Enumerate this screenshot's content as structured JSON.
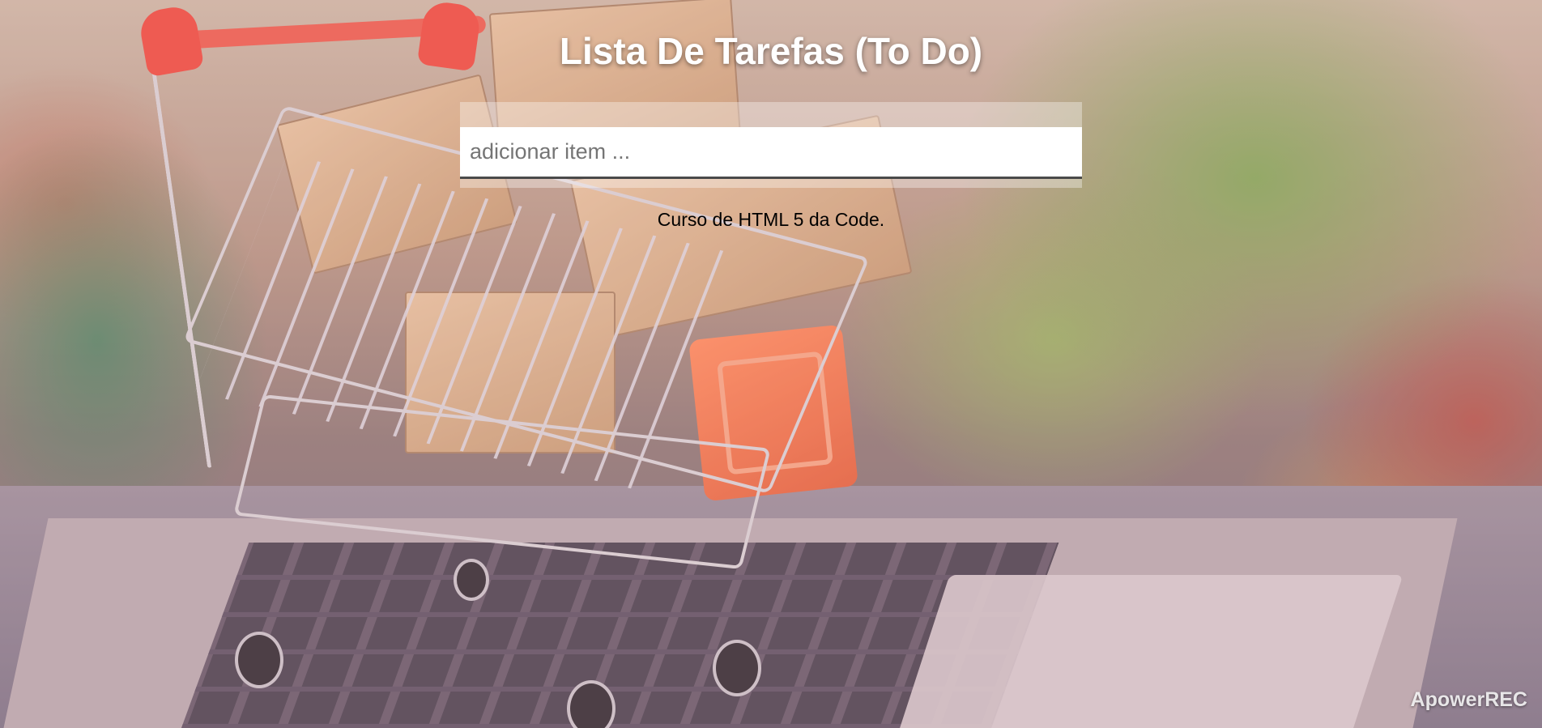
{
  "header": {
    "title": "Lista De Tarefas (To Do)"
  },
  "form": {
    "input_placeholder": "adicionar item ...",
    "input_value": ""
  },
  "credit": {
    "text": "Curso de HTML 5 da Code."
  },
  "watermark": {
    "text": "ApowerREC"
  },
  "background": {
    "image": "shopping-cart-on-laptop-photo"
  }
}
